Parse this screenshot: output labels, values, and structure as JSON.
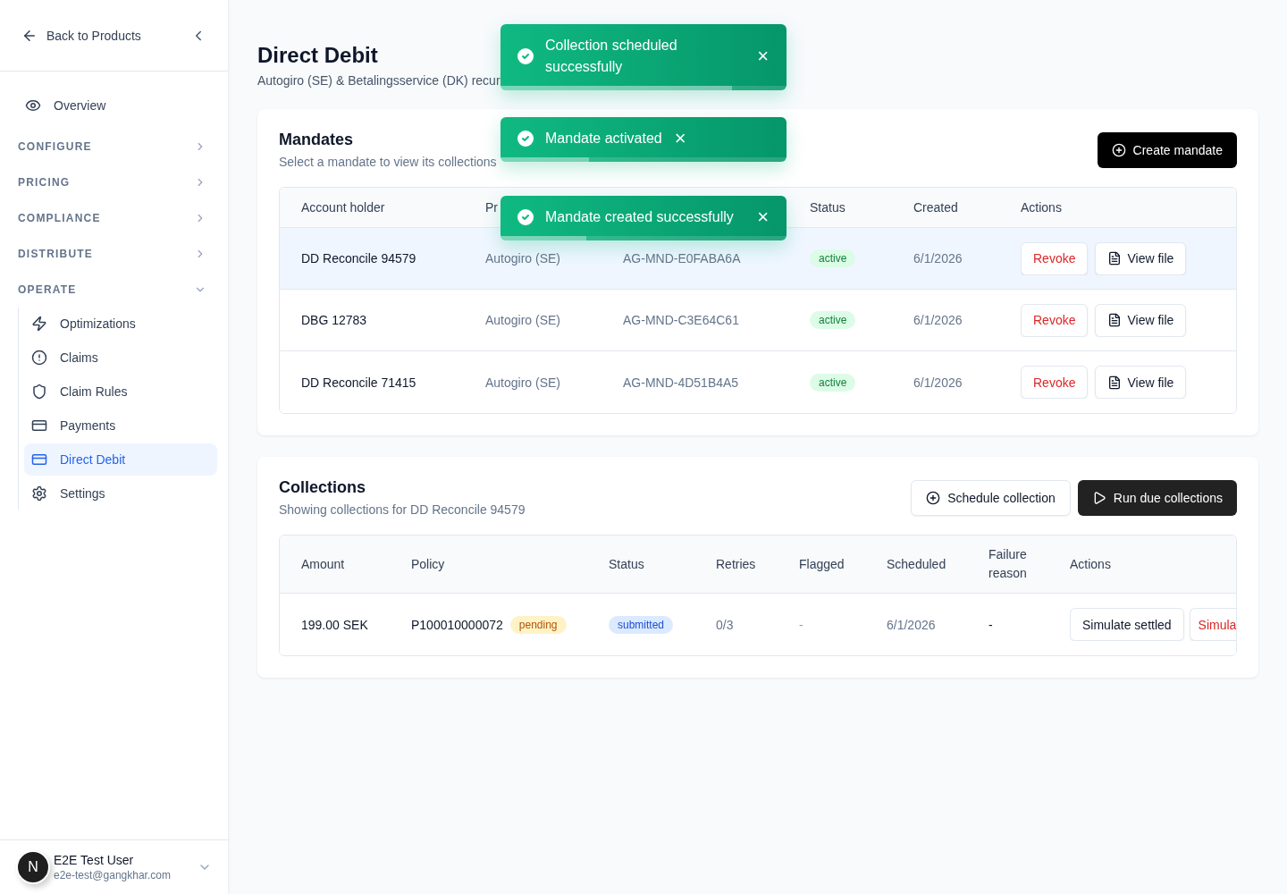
{
  "sidebar": {
    "back_label": "Back to Products",
    "items": [
      {
        "kind": "link",
        "label": "Overview",
        "selected": false
      },
      {
        "kind": "section",
        "label": "CONFIGURE",
        "expanded": false
      },
      {
        "kind": "section",
        "label": "PRICING",
        "expanded": false
      },
      {
        "kind": "section",
        "label": "COMPLIANCE",
        "expanded": false
      },
      {
        "kind": "section",
        "label": "DISTRIBUTE",
        "expanded": false
      },
      {
        "kind": "section",
        "label": "OPERATE",
        "expanded": true,
        "children": [
          {
            "label": "Optimizations",
            "selected": false
          },
          {
            "label": "Claims",
            "selected": false
          },
          {
            "label": "Claim Rules",
            "selected": false
          },
          {
            "label": "Payments",
            "selected": false
          },
          {
            "label": "Direct Debit",
            "selected": true
          },
          {
            "label": "Settings",
            "selected": false
          }
        ]
      }
    ],
    "user": {
      "initial": "N",
      "name": "E2E Test User",
      "email": "e2e-test@gangkhar.com"
    }
  },
  "page": {
    "title": "Direct Debit",
    "subtitle": "Autogiro (SE) & Betalingsservice (DK) recur"
  },
  "mandates": {
    "title": "Mandates",
    "subtitle": "Select a mandate to view its collections",
    "create_button": "Create mandate",
    "columns": [
      "Account holder",
      "Pr",
      "",
      "Status",
      "Created",
      "Actions"
    ],
    "rows": [
      {
        "holder": "DD Reconcile 94579",
        "provider": "Autogiro (SE)",
        "reference": "AG-MND-E0FABA6A",
        "status": "active",
        "created": "6/1/2026",
        "revoke": "Revoke",
        "view": "View file",
        "selected": true
      },
      {
        "holder": "DBG 12783",
        "provider": "Autogiro (SE)",
        "reference": "AG-MND-C3E64C61",
        "status": "active",
        "created": "6/1/2026",
        "revoke": "Revoke",
        "view": "View file",
        "selected": false
      },
      {
        "holder": "DD Reconcile 71415",
        "provider": "Autogiro (SE)",
        "reference": "AG-MND-4D51B4A5",
        "status": "active",
        "created": "6/1/2026",
        "revoke": "Revoke",
        "view": "View file",
        "selected": false
      }
    ]
  },
  "collections": {
    "title": "Collections",
    "subtitle": "Showing collections for DD Reconcile 94579",
    "schedule_button": "Schedule collection",
    "run_button": "Run due collections",
    "columns": [
      "Amount",
      "Policy",
      "Status",
      "Retries",
      "Flagged",
      "Scheduled",
      "Failure reason",
      "Actions"
    ],
    "rows": [
      {
        "amount": "199.00 SEK",
        "policy": "P100010000072",
        "policy_status": "pending",
        "status": "submitted",
        "retries": "0/3",
        "flagged": "-",
        "scheduled": "6/1/2026",
        "failure": "-",
        "settle": "Simulate settled",
        "fail": "Simula"
      }
    ]
  },
  "toasts": [
    {
      "message": "Collection scheduled successfully",
      "close": "×",
      "level": 0.81
    },
    {
      "message": "Mandate activated",
      "close": "×",
      "level": 0.31
    },
    {
      "message": "Mandate created successfully",
      "close": "×",
      "level": 0.3
    }
  ]
}
